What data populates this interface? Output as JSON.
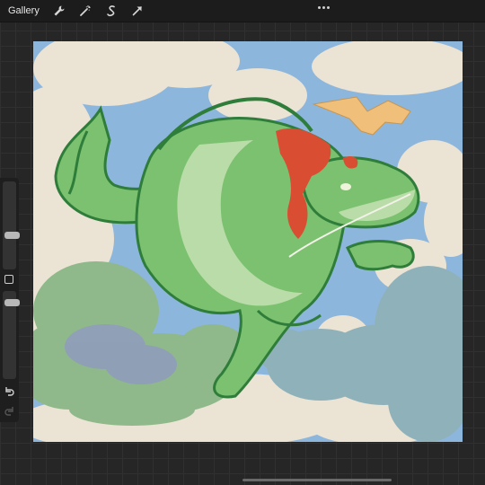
{
  "topbar": {
    "gallery_label": "Gallery",
    "tools": [
      {
        "name": "wrench-icon",
        "glyph": "wrench"
      },
      {
        "name": "magic-wand-icon",
        "glyph": "wand"
      },
      {
        "name": "selection-icon",
        "glyph": "s-curve"
      },
      {
        "name": "transform-arrow-icon",
        "glyph": "arrow"
      }
    ],
    "more_menu": "more-dots-icon"
  },
  "sidebar": {
    "brush_size_level": 0.4,
    "opacity_level": 0.05,
    "modify_button": "square-icon",
    "undo_icon": "undo-icon",
    "redo_icon": "redo-icon"
  },
  "canvas": {
    "sky_color": "#8db6dd",
    "cloud_color": "#ebe3d3",
    "dragon_color": "#7bc16f",
    "dragon_outline": "#2f7d3a",
    "belly_color": "#b9dca8",
    "scarf_color": "#d94e32",
    "bird_color": "#f0c07a",
    "smoke_green": "#8fb98a",
    "smoke_blue": "#8eb1ba"
  }
}
